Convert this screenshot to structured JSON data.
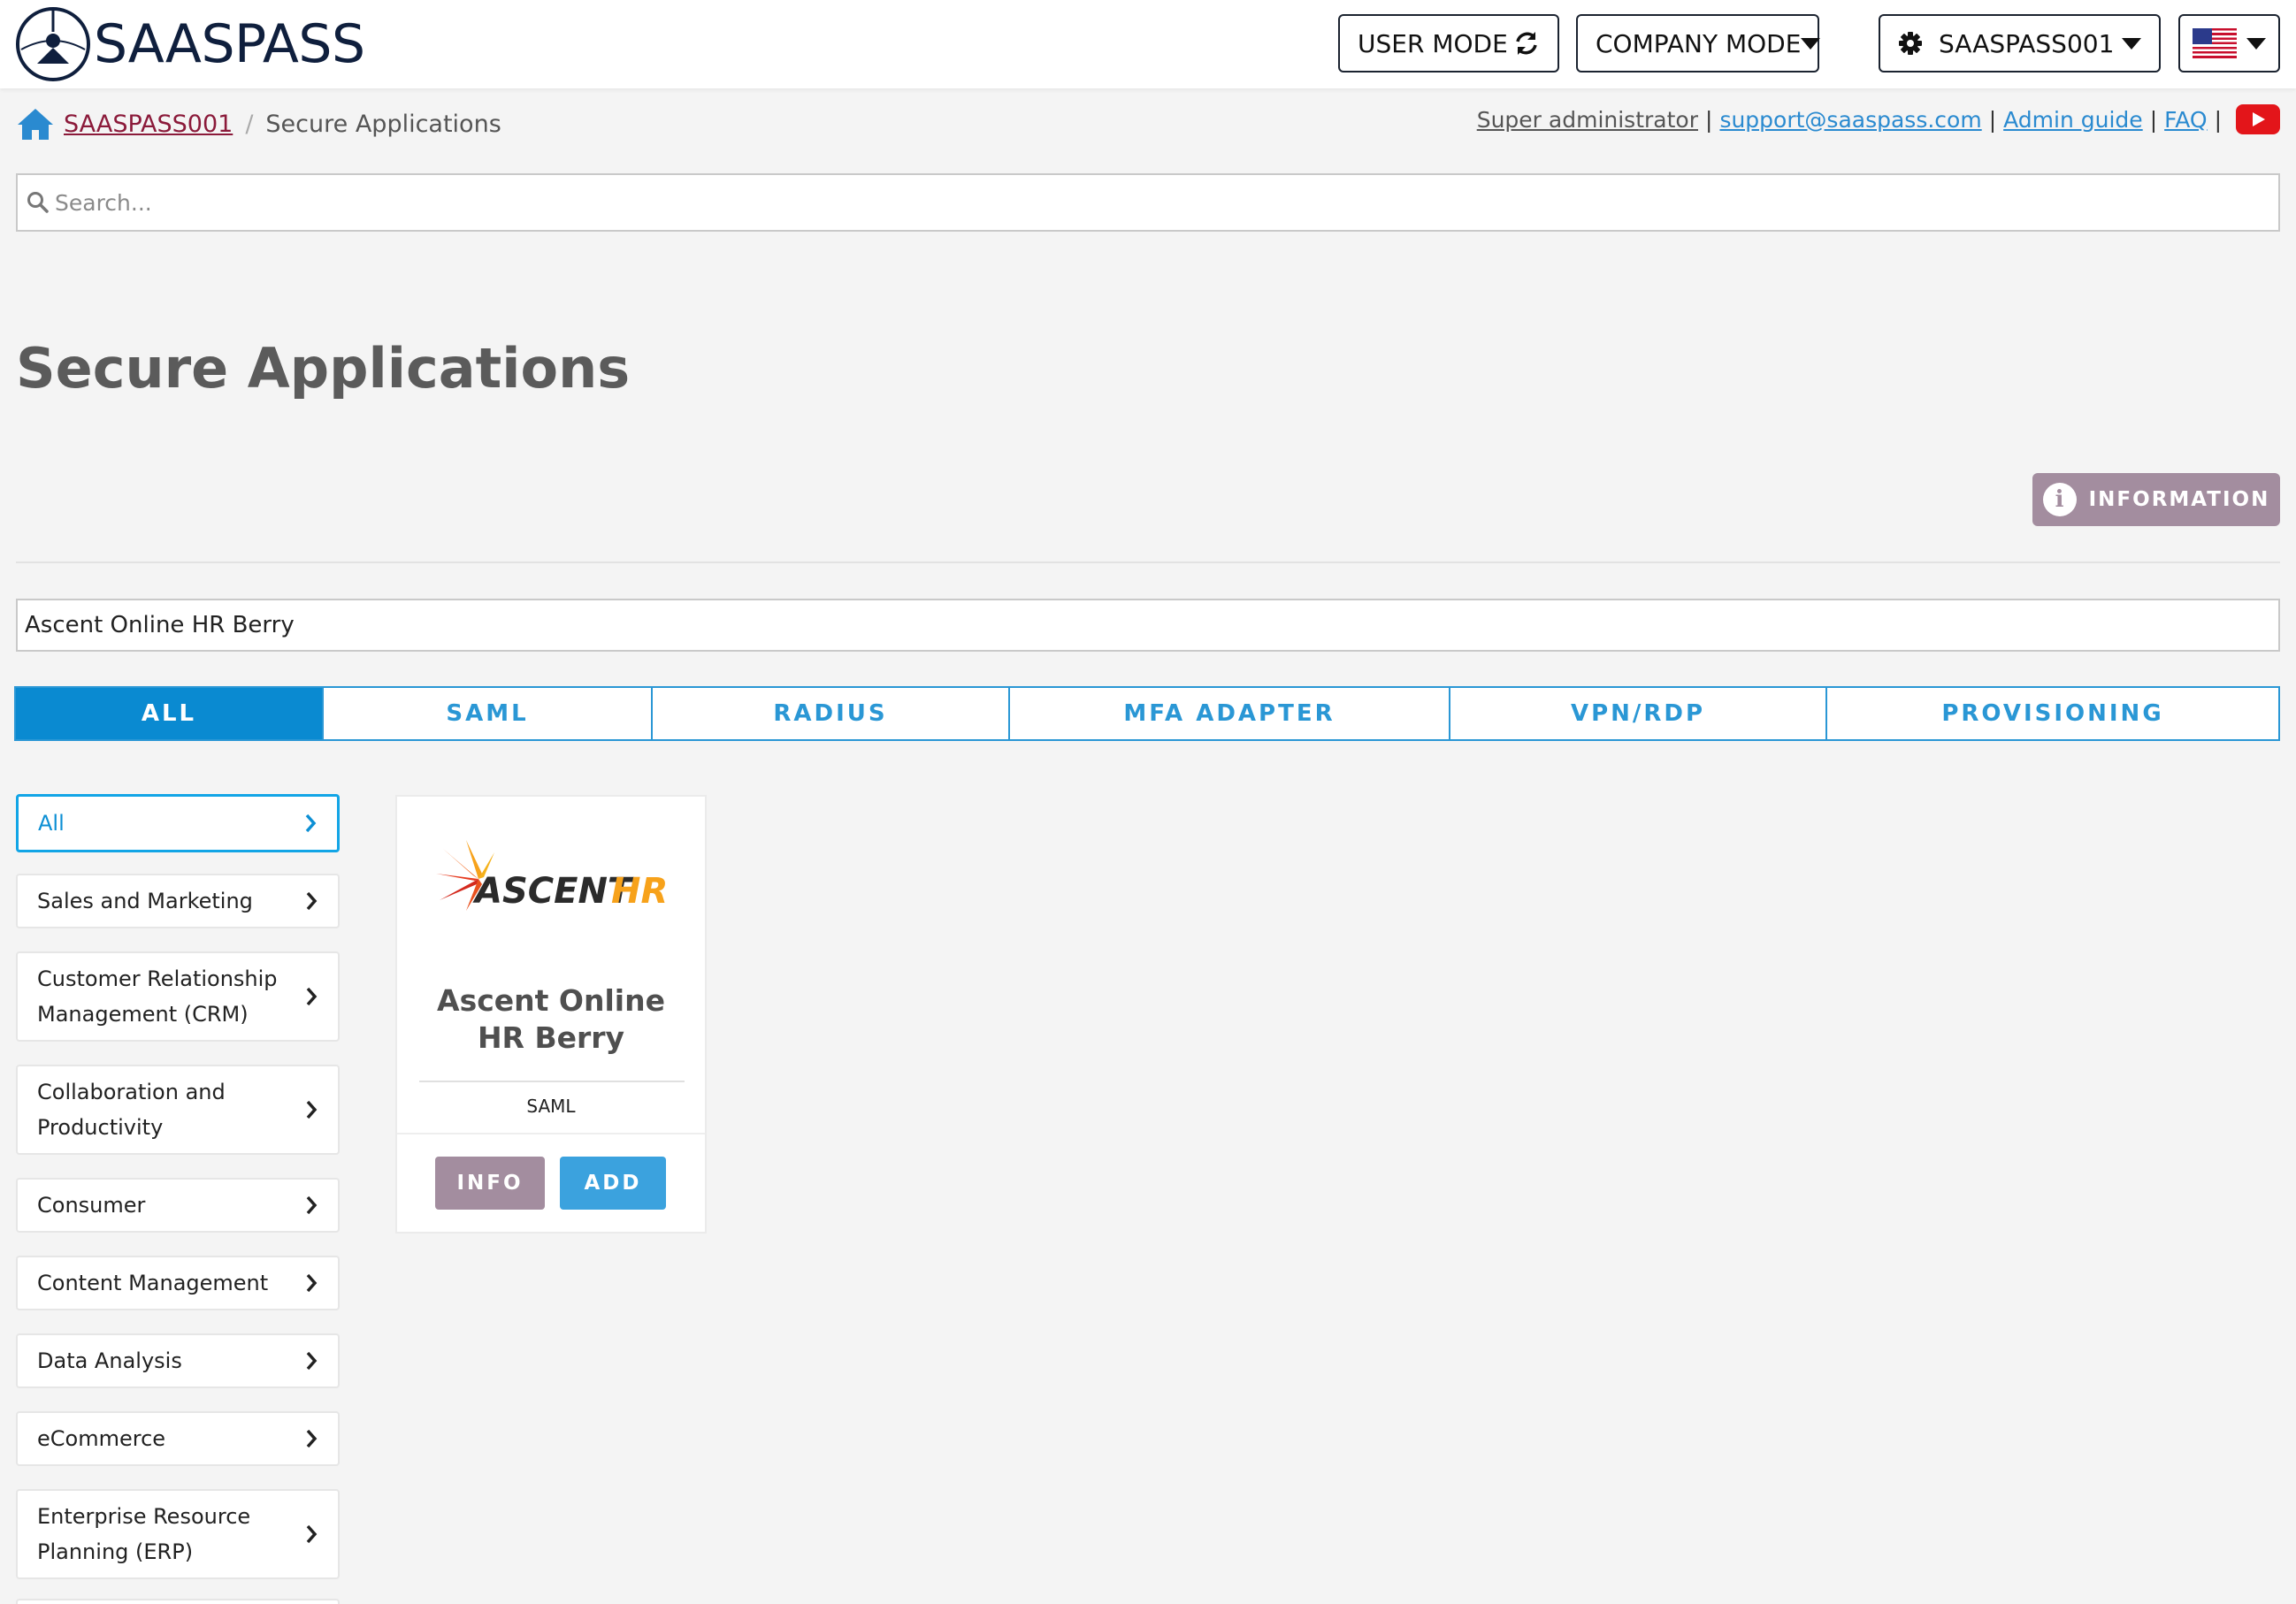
{
  "header": {
    "logo_text": "SAASPASS",
    "user_mode_label": "USER MODE",
    "company_mode_label": "COMPANY MODE",
    "account_label": "SAASPASS001",
    "language_icon": "us-flag-icon"
  },
  "breadcrumb": {
    "home": "SAASPASS001",
    "separator": "/",
    "current": "Secure Applications"
  },
  "top_links": {
    "role": "Super administrator ",
    "support": "support@saaspass.com",
    "admin_guide": "Admin guide",
    "faq": "FAQ",
    "separator": "|"
  },
  "search": {
    "placeholder": "Search..."
  },
  "page": {
    "title": "Secure Applications",
    "information_label": "INFORMATION",
    "info_icon_glyph": "i",
    "filter_value": "Ascent Online HR Berry"
  },
  "tabs": [
    {
      "label": "ALL",
      "active": true
    },
    {
      "label": "SAML",
      "active": false
    },
    {
      "label": "RADIUS",
      "active": false
    },
    {
      "label": "MFA ADAPTER",
      "active": false
    },
    {
      "label": "VPN/RDP",
      "active": false
    },
    {
      "label": "PROVISIONING",
      "active": false
    }
  ],
  "categories": [
    {
      "label": "All",
      "active": true
    },
    {
      "label": "Sales and Marketing"
    },
    {
      "label": "Customer Relationship Management (CRM)"
    },
    {
      "label": "Collaboration and Productivity"
    },
    {
      "label": "Consumer"
    },
    {
      "label": "Content Management"
    },
    {
      "label": "Data Analysis"
    },
    {
      "label": "eCommerce"
    },
    {
      "label": "Enterprise Resource Planning (ERP)"
    }
  ],
  "apps": [
    {
      "name": "Ascent Online HR Berry",
      "type": "SAML",
      "logo_text_main": "ASCENT",
      "logo_text_accent": "HR",
      "info_label": "INFO",
      "add_label": "ADD"
    }
  ],
  "colors": {
    "accent_blue": "#0a8ad1",
    "info_purple": "#a38d9f",
    "link_blue": "#2a8ad0",
    "breadcrumb_maroon": "#8b1a3a"
  }
}
